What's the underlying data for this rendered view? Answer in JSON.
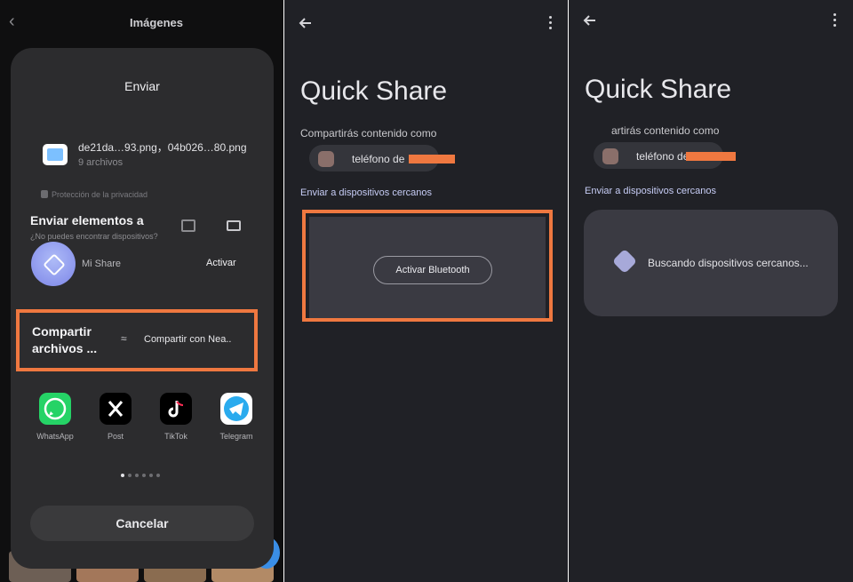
{
  "screen1": {
    "header_title": "Imágenes",
    "sheet": {
      "title": "Enviar",
      "file_name": "de21da…93.png，04b026…80.png",
      "file_count": "9 archivos",
      "privacy": "Protección de la privacidad",
      "send_heading": "Enviar elementos a",
      "cant_find": "¿No puedes encontrar dispositivos?",
      "mi_share": "Mi Share",
      "activate": "Activar",
      "share_files": "Compartir archivos ...",
      "nearby_share": "Compartir con Nea..",
      "apps": [
        {
          "label": "WhatsApp",
          "icon": "whatsapp-icon",
          "color": "#25D366"
        },
        {
          "label": "Post",
          "icon": "x-icon",
          "color": "#000000"
        },
        {
          "label": "TikTok",
          "icon": "tiktok-icon",
          "color": "#000000"
        },
        {
          "label": "Telegram",
          "icon": "telegram-icon",
          "color": "#2AABEE"
        }
      ],
      "page_dots": 6,
      "page_dot_active": 1,
      "cancel": "Cancelar"
    }
  },
  "screen2": {
    "title": "Quick Share",
    "share_as": "Compartirás contenido como",
    "device_name": "teléfono de",
    "nearby_link": "Enviar a dispositivos cercanos",
    "bluetooth_button": "Activar Bluetooth"
  },
  "screen3": {
    "title": "Quick Share",
    "share_as": "artirás contenido como",
    "device_name": "teléfono de",
    "nearby_link": "Enviar a dispositivos cercanos",
    "searching": "Buscando dispositivos cercanos..."
  },
  "colors": {
    "highlight": "#ef7840",
    "link": "#c7cdf6"
  }
}
